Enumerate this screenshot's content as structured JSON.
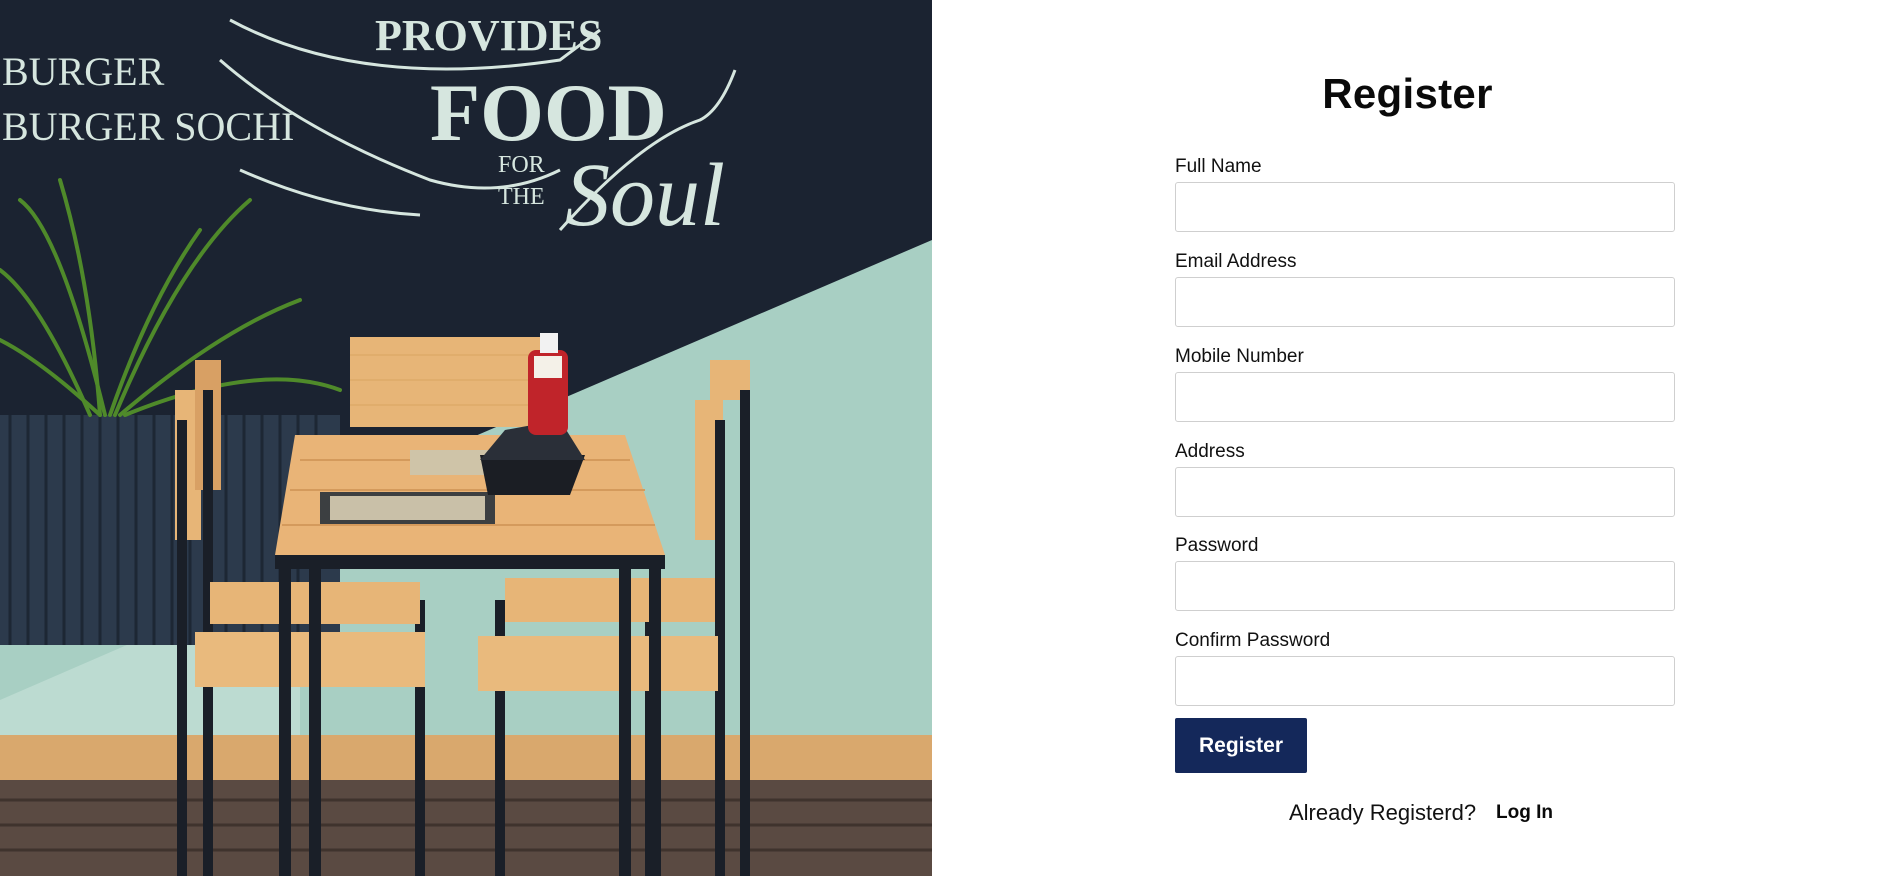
{
  "form": {
    "title": "Register",
    "fields": [
      {
        "label": "Full Name",
        "value": "",
        "placeholder": ""
      },
      {
        "label": "Email Address",
        "value": "",
        "placeholder": ""
      },
      {
        "label": "Mobile Number",
        "value": "",
        "placeholder": ""
      },
      {
        "label": "Address",
        "value": "",
        "placeholder": ""
      },
      {
        "label": "Password",
        "value": "",
        "placeholder": ""
      },
      {
        "label": "Confirm Password",
        "value": "",
        "placeholder": ""
      }
    ],
    "submit_label": "Register",
    "already_text": "Already Registerd?",
    "login_label": "Log In"
  },
  "hero": {
    "chalk_lines": [
      "BURGER",
      "BURGER SOCHI",
      "PROVIDES",
      "FOOD",
      "FOR",
      "THE",
      "Soul"
    ]
  },
  "colors": {
    "button_bg": "#14285a",
    "chalkboard": "#1b2331",
    "wall": "#a8cfc3",
    "wood": "#e7b577"
  }
}
